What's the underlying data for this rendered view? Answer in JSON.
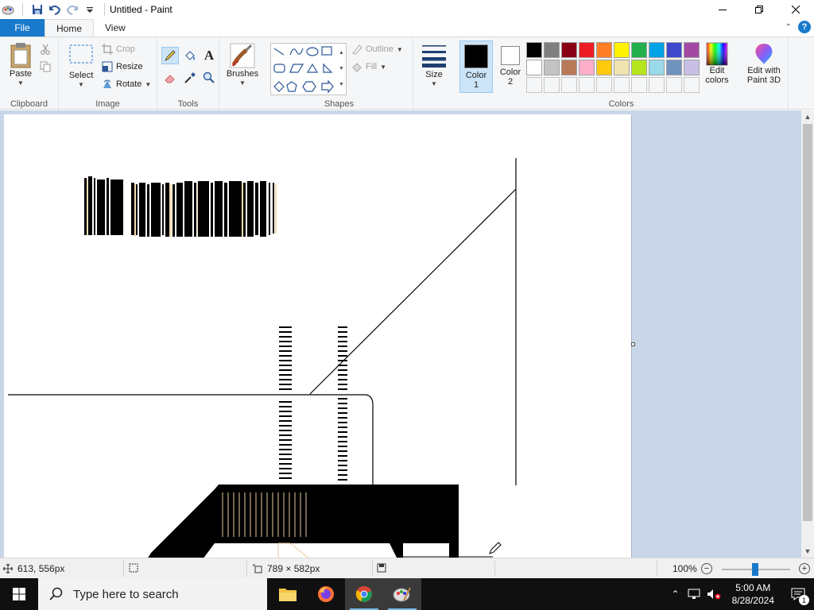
{
  "window": {
    "title": "Untitled - Paint",
    "controls": [
      "minimize",
      "maximize",
      "close"
    ]
  },
  "tabs": {
    "file": "File",
    "home": "Home",
    "view": "View"
  },
  "ribbon": {
    "clipboard": {
      "label": "Clipboard",
      "paste": "Paste"
    },
    "image": {
      "label": "Image",
      "select": "Select",
      "crop": "Crop",
      "resize": "Resize",
      "rotate": "Rotate"
    },
    "tools": {
      "label": "Tools"
    },
    "brushes": {
      "label": "Brushes"
    },
    "shapes": {
      "label": "Shapes",
      "outline": "Outline",
      "fill": "Fill"
    },
    "size": {
      "label": "Size"
    },
    "colors": {
      "label": "Colors",
      "color1_line1": "Color",
      "color1_line2": "1",
      "color2_line1": "Color",
      "color2_line2": "2",
      "color1_value": "#000000",
      "color2_value": "#ffffff",
      "edit_colors_line1": "Edit",
      "edit_colors_line2": "colors",
      "palette_row1": [
        "#000000",
        "#7f7f7f",
        "#880015",
        "#ed1c24",
        "#ff7f27",
        "#fff200",
        "#22b14c",
        "#00a2e8",
        "#3f48cc",
        "#a349a4"
      ],
      "palette_row2": [
        "#ffffff",
        "#c3c3c3",
        "#b97a57",
        "#ffaec9",
        "#ffc90e",
        "#efe4b0",
        "#b5e61d",
        "#99d9ea",
        "#7092be",
        "#c8bfe7"
      ]
    },
    "paint3d": {
      "line1": "Edit with",
      "line2": "Paint 3D"
    }
  },
  "status": {
    "cursor_pos": "613, 556px",
    "selection_size": "",
    "canvas_size": "789 × 582px",
    "zoom": "100%",
    "zoom_level": 1.0
  },
  "taskbar": {
    "search_placeholder": "Type here to search",
    "time": "5:00 AM",
    "date": "8/28/2024",
    "notification_count": "1",
    "apps": [
      "file-explorer",
      "firefox",
      "chrome",
      "paint"
    ]
  }
}
